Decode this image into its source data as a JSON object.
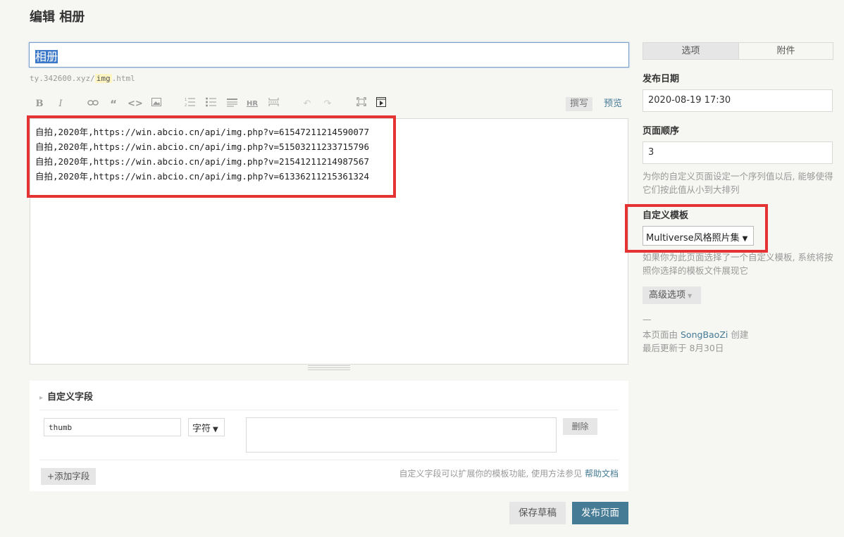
{
  "header": {
    "title": "编辑 相册"
  },
  "editor": {
    "title_value": "相册",
    "slug": {
      "prefix": "ty.342600.xyz/",
      "value": "img",
      "suffix": ".html"
    },
    "toolbar": {
      "icons": [
        "bold-icon",
        "italic-icon",
        "link-icon",
        "quote-icon",
        "code-icon",
        "image-icon",
        "ordered-list-icon",
        "unordered-list-icon",
        "heading-icon",
        "horizontal-rule-icon",
        "more-icon",
        "undo-icon",
        "redo-icon",
        "fullscreen-icon",
        "media-icon"
      ],
      "bold_glyph": "B",
      "italic_glyph": "I",
      "hr_glyph": "HR",
      "write_tab": "撰写",
      "preview_tab": "预览"
    },
    "content_lines": [
      "自拍,2020年,https://win.abcio.cn/api/img.php?v=61547211214590077",
      "自拍,2020年,https://win.abcio.cn/api/img.php?v=51503211233715796",
      "自拍,2020年,https://win.abcio.cn/api/img.php?v=21541211214987567",
      "自拍,2020年,https://win.abcio.cn/api/img.php?v=61336211215361324"
    ]
  },
  "custom_fields": {
    "title": "自定义字段",
    "field_name": "thumb",
    "field_type": "字符",
    "field_value": "",
    "delete_label": "删除",
    "add_label": "+添加字段",
    "hint": "自定义字段可以扩展你的模板功能, 使用方法参见",
    "help_link": "帮助文档"
  },
  "actions": {
    "save_draft": "保存草稿",
    "publish": "发布页面"
  },
  "sidebar": {
    "tabs": [
      "选项",
      "附件"
    ],
    "publish_date": {
      "label": "发布日期",
      "value": "2020-08-19 17:30"
    },
    "order": {
      "label": "页面顺序",
      "value": "3",
      "hint": "为你的自定义页面设定一个序列值以后, 能够使得它们按此值从小到大排列"
    },
    "template": {
      "label": "自定义模板",
      "value": "Multiverse风格照片集",
      "hint": "如果你为此页面选择了一个自定义模板, 系统将按照你选择的模板文件展现它"
    },
    "advanced": "高级选项",
    "separator": "—",
    "created_prefix": "本页面由",
    "author": "SongBaoZi",
    "created_suffix": "创建",
    "updated": "最后更新于 8月30日"
  },
  "colors": {
    "accent": "#467b96",
    "highlight_box": "#e53333",
    "background": "#f6f6f3"
  }
}
